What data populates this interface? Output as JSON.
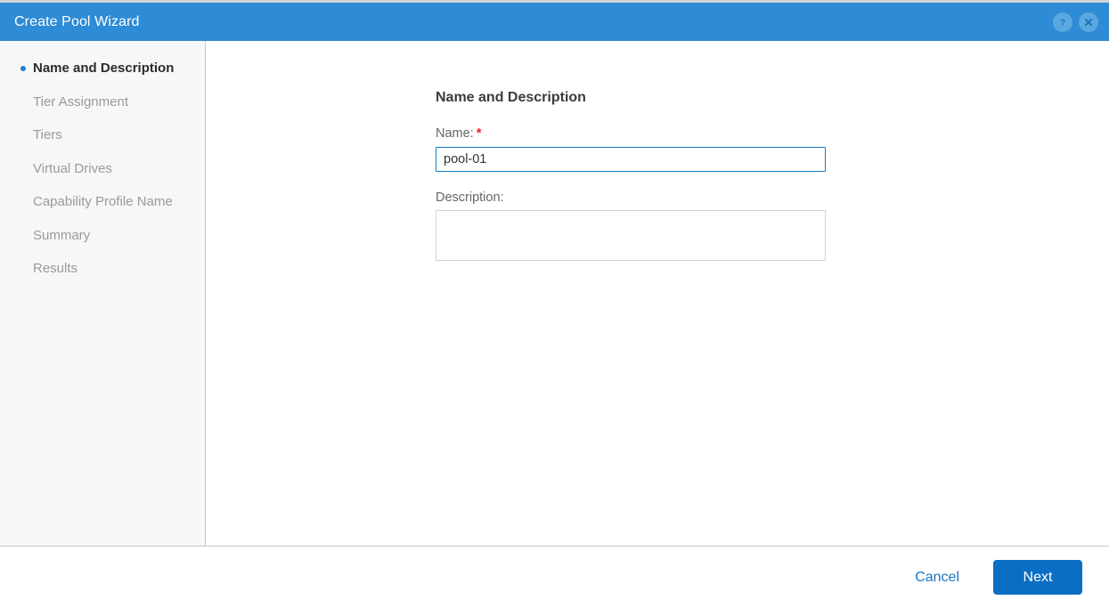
{
  "window": {
    "title": "Create Pool Wizard",
    "header_color": "#2e8bd5",
    "help_icon": "help-circle-icon",
    "close_icon": "close-circle-icon"
  },
  "sidebar": {
    "items": [
      {
        "label": "Name and Description",
        "active": true
      },
      {
        "label": "Tier Assignment",
        "active": false
      },
      {
        "label": "Tiers",
        "active": false
      },
      {
        "label": "Virtual Drives",
        "active": false
      },
      {
        "label": "Capability Profile Name",
        "active": false
      },
      {
        "label": "Summary",
        "active": false
      },
      {
        "label": "Results",
        "active": false
      }
    ],
    "active_marker_color": "#1f7fd4"
  },
  "content": {
    "section_title": "Name and Description",
    "name_field": {
      "label": "Name:",
      "required_marker": "*",
      "required_color": "#e8232a",
      "value": "pool-01",
      "placeholder": ""
    },
    "description_field": {
      "label": "Description:",
      "value": "",
      "placeholder": ""
    }
  },
  "footer": {
    "cancel_label": "Cancel",
    "next_label": "Next",
    "primary_color": "#0a6ec4",
    "link_color": "#1a73c8"
  }
}
